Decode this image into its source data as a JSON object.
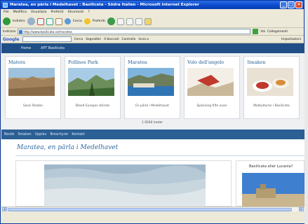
{
  "window": {
    "title": "Maratea, en pärla i Medelhavet : Basilicata - Södra Italien - Microsoft Internet Explorer"
  },
  "menu": [
    "File",
    "Modifica",
    "Visualizza",
    "Preferiti",
    "Strumenti",
    "?"
  ],
  "toolbar": {
    "back_label": "Indietro",
    "search_label": "Cerca",
    "favorites_label": "Preferiti"
  },
  "address": {
    "label": "Indirizzo",
    "url": "http://www.basilicata.se/maratea",
    "go_label": "Vai",
    "links_label": "Collegamenti"
  },
  "google": {
    "logo": "Google",
    "search_label": "Cerca",
    "bookmarks_label": "Segnalibri",
    "blocked_label": "0 bloccati",
    "check_label": "Controllo",
    "send_label": "Invia a",
    "settings_label": "Impostazioni"
  },
  "site_nav": [
    "Home",
    "APT Basilicata"
  ],
  "cards": [
    {
      "title": "Matera",
      "caption": "Sassi Staden"
    },
    {
      "title": "Pollinos Park",
      "caption": "Bland Europas största"
    },
    {
      "title": "Marateа",
      "caption": "En pärla i Medelhavet"
    },
    {
      "title": "Volo dell'angelo",
      "caption": "Spänning från ovan"
    },
    {
      "title": "Smaken",
      "caption": "Matkulturen i Basilicata"
    }
  ],
  "strip_meter": "1 0240 meter",
  "subnav": [
    "Besök",
    "Smaken",
    "Upplev",
    "Broschyrer",
    "Kontakt"
  ],
  "page_title": "Maratea, en pärla i Medelhavet",
  "side_title": "Basilicata eller Lucania?"
}
